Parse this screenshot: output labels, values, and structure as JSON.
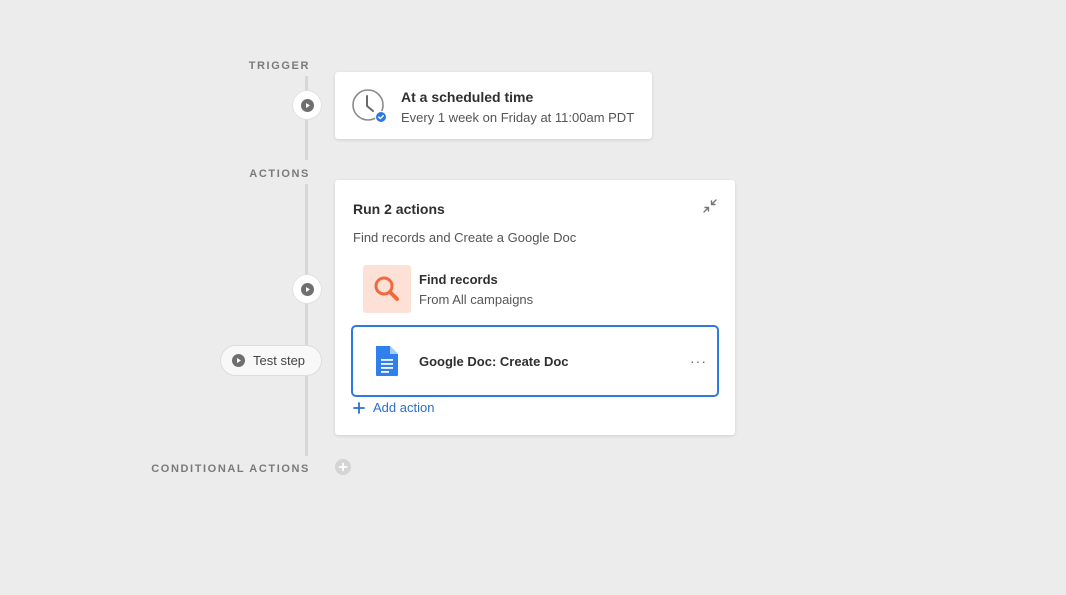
{
  "timeline": {
    "trigger_label": "TRIGGER",
    "actions_label": "ACTIONS",
    "conditional_label": "CONDITIONAL ACTIONS",
    "test_step_label": "Test step"
  },
  "trigger": {
    "title": "At a scheduled time",
    "subtitle": "Every 1 week on Friday at 11:00am PDT",
    "icon": "clock-icon",
    "badge_icon": "check-badge-icon"
  },
  "actions": {
    "title": "Run 2 actions",
    "description": "Find records and Create a Google Doc",
    "steps": [
      {
        "title": "Find records",
        "subtitle": "From All campaigns",
        "icon": "search-icon",
        "tile_color": "#fde0d6",
        "icon_color": "#ef6a3c"
      },
      {
        "title": "Google Doc: Create Doc",
        "icon": "google-doc-icon",
        "icon_color": "#2f80ed",
        "selected": true,
        "more_label": "···"
      }
    ],
    "add_action_label": "Add action"
  },
  "colors": {
    "accent": "#2a7ae2",
    "background": "#ececec"
  }
}
